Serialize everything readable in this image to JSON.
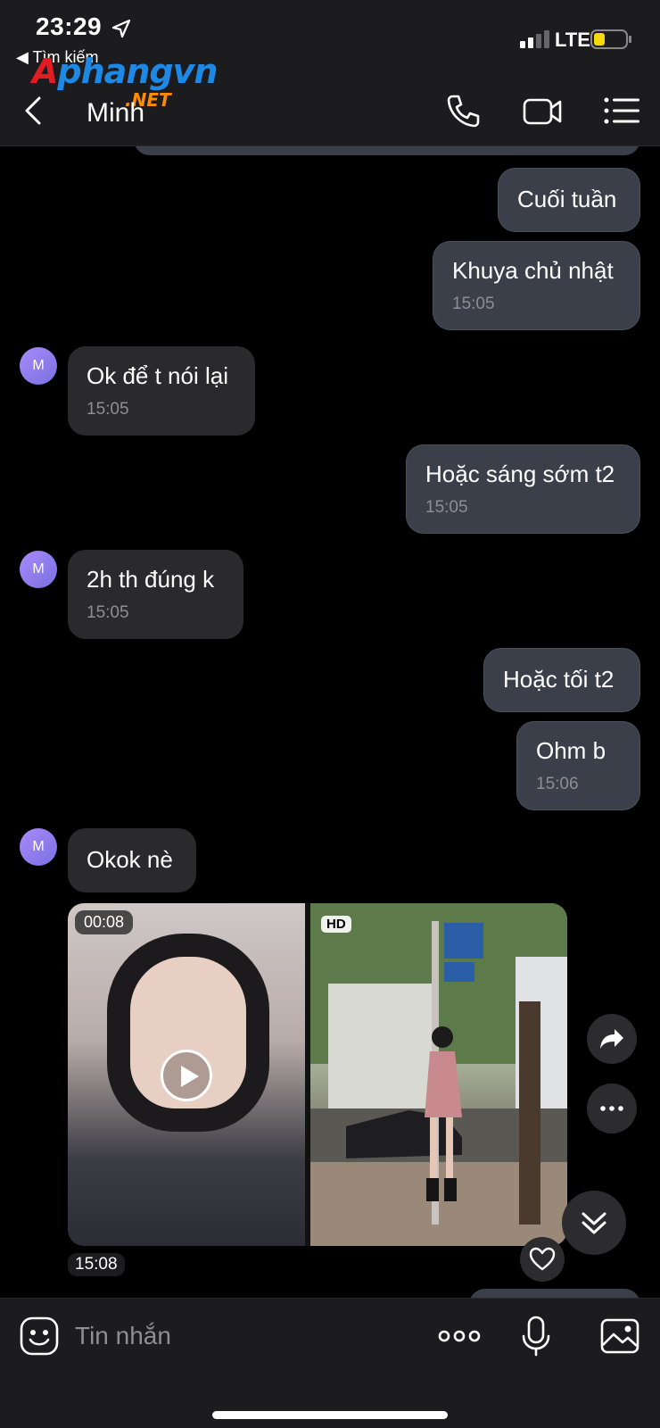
{
  "status": {
    "time": "23:29",
    "network": "LTE",
    "back_app": "◀ Tìm kiếm"
  },
  "watermark": {
    "brand": "Aphangvn",
    "suffix": ".NET"
  },
  "header": {
    "title": "Minh",
    "icons": [
      "back-icon",
      "phone-icon",
      "video-call-icon",
      "menu-icon"
    ]
  },
  "messages": [
    {
      "dir": "out",
      "text": "Cuối tuần",
      "time": ""
    },
    {
      "dir": "out",
      "text": "Khuya chủ nhật",
      "time": "15:05"
    },
    {
      "dir": "in",
      "avatar": "M",
      "text": "Ok để t nói lại",
      "time": "15:05"
    },
    {
      "dir": "out",
      "text": "Hoặc sáng sớm t2",
      "time": "15:05"
    },
    {
      "dir": "in",
      "avatar": "M",
      "text": "2h th đúng k",
      "time": "15:05"
    },
    {
      "dir": "out",
      "text": "Hoặc tối t2",
      "time": ""
    },
    {
      "dir": "out",
      "text": "Ohm b",
      "time": "15:06"
    },
    {
      "dir": "in",
      "avatar": "M",
      "text": "Okok nè",
      "time": ""
    }
  ],
  "media": {
    "video_duration": "00:08",
    "photo_badge": "HD",
    "time": "15:08"
  },
  "input": {
    "placeholder": "Tin nhắn"
  },
  "colors": {
    "outgoing_bubble": "#3a3f49",
    "incoming_bubble": "#2a2a2c",
    "background": "#000000",
    "bar": "#1c1c1e"
  }
}
